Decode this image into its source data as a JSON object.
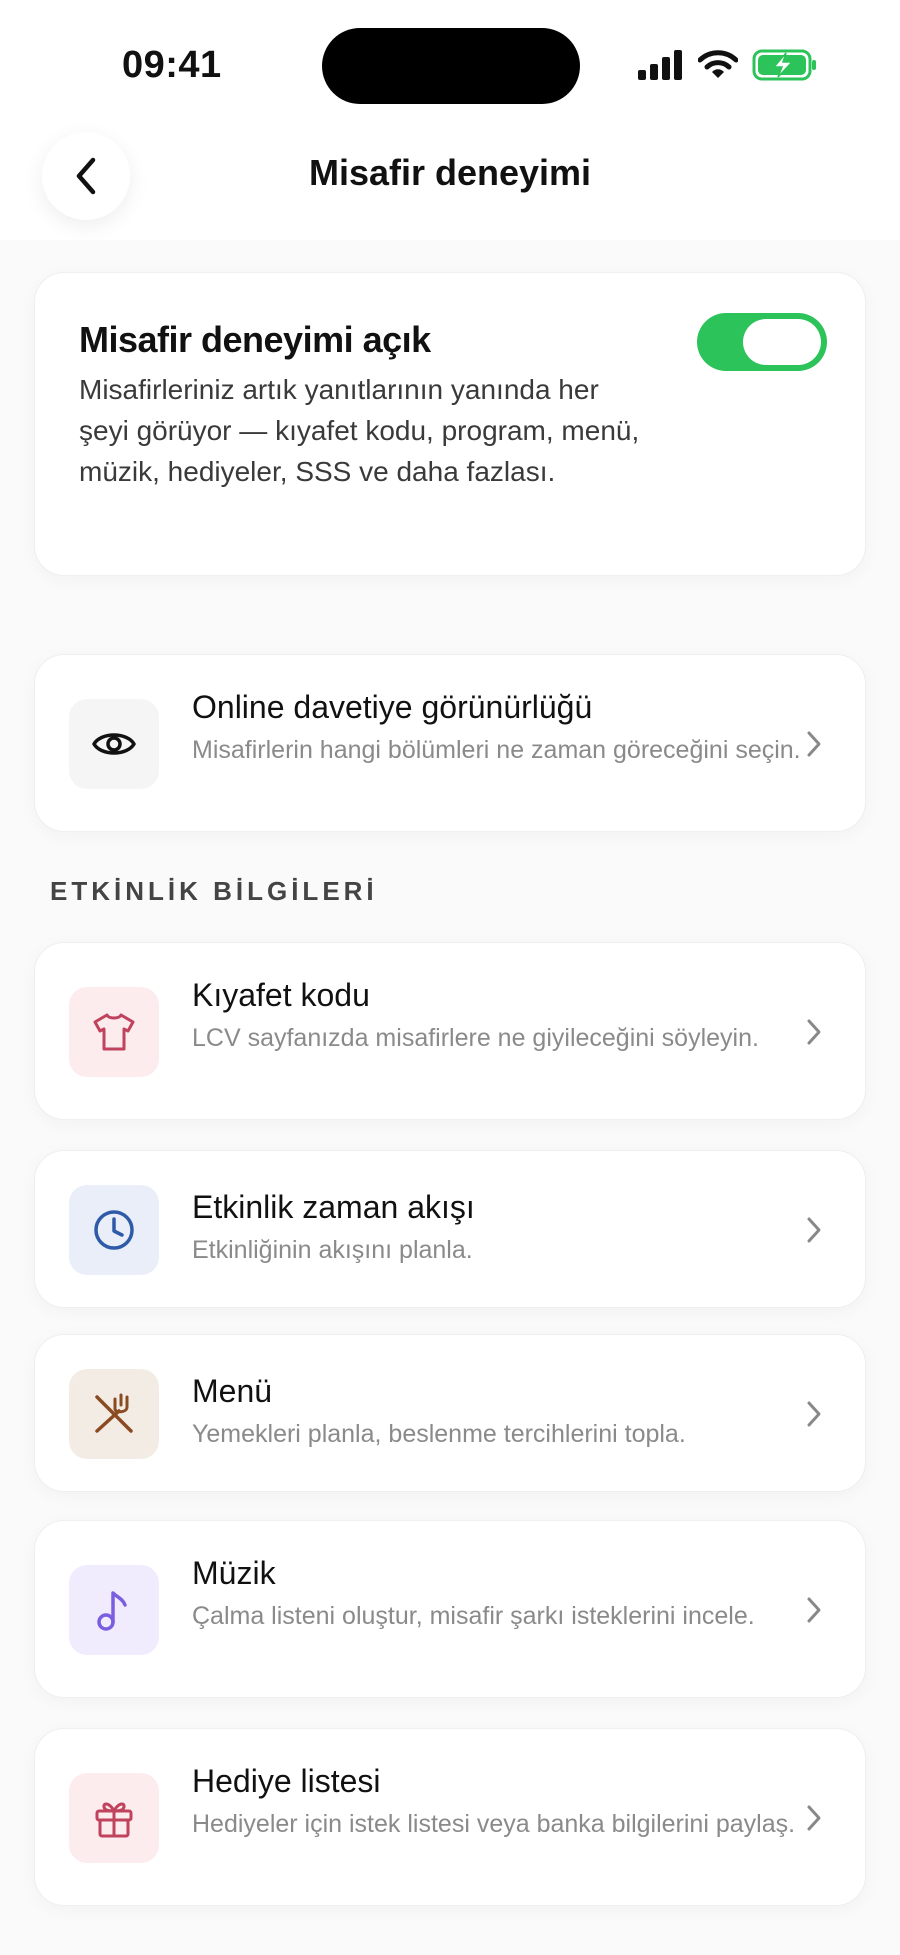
{
  "status_bar": {
    "time": "09:41"
  },
  "header": {
    "title": "Misafir deneyimi"
  },
  "guest_experience": {
    "title": "Misafir deneyimi açık",
    "description": "Misafirleriniz artık yanıtlarının yanında her şeyi görüyor — kıyafet kodu, program, menü, müzik, hediyeler, SSS ve daha fazlası.",
    "enabled": true,
    "toggle_color": "#2cc35a"
  },
  "visibility": {
    "title": "Online davetiye görünürlüğü",
    "subtitle": "Misafirlerin hangi bölümleri ne zaman göreceğini seçin.",
    "icon": "eye-icon"
  },
  "section_label": "ETKİNLİK BİLGİLERİ",
  "items": [
    {
      "title": "Kıyafet kodu",
      "subtitle": "LCV sayfanızda misafirlere ne giyileceğini söyleyin.",
      "icon": "shirt-icon",
      "tile_color": "#fcecee",
      "icon_color": "#c0425c"
    },
    {
      "title": "Etkinlik zaman akışı",
      "subtitle": "Etkinliğinin akışını planla.",
      "icon": "clock-icon",
      "tile_color": "#e9eef8",
      "icon_color": "#2f5aa8"
    },
    {
      "title": "Menü",
      "subtitle": "Yemekleri planla, beslenme tercihlerini topla.",
      "icon": "fork-knife-icon",
      "tile_color": "#f3ece4",
      "icon_color": "#8a4a22"
    },
    {
      "title": "Müzik",
      "subtitle": "Çalma listeni oluştur, misafir şarkı isteklerini incele.",
      "icon": "music-note-icon",
      "tile_color": "#f1ecfd",
      "icon_color": "#7b5ee0"
    },
    {
      "title": "Hediye listesi",
      "subtitle": "Hediyeler için istek listesi veya banka bilgilerini paylaş.",
      "icon": "gift-icon",
      "tile_color": "#fcecee",
      "icon_color": "#c0425c"
    }
  ]
}
